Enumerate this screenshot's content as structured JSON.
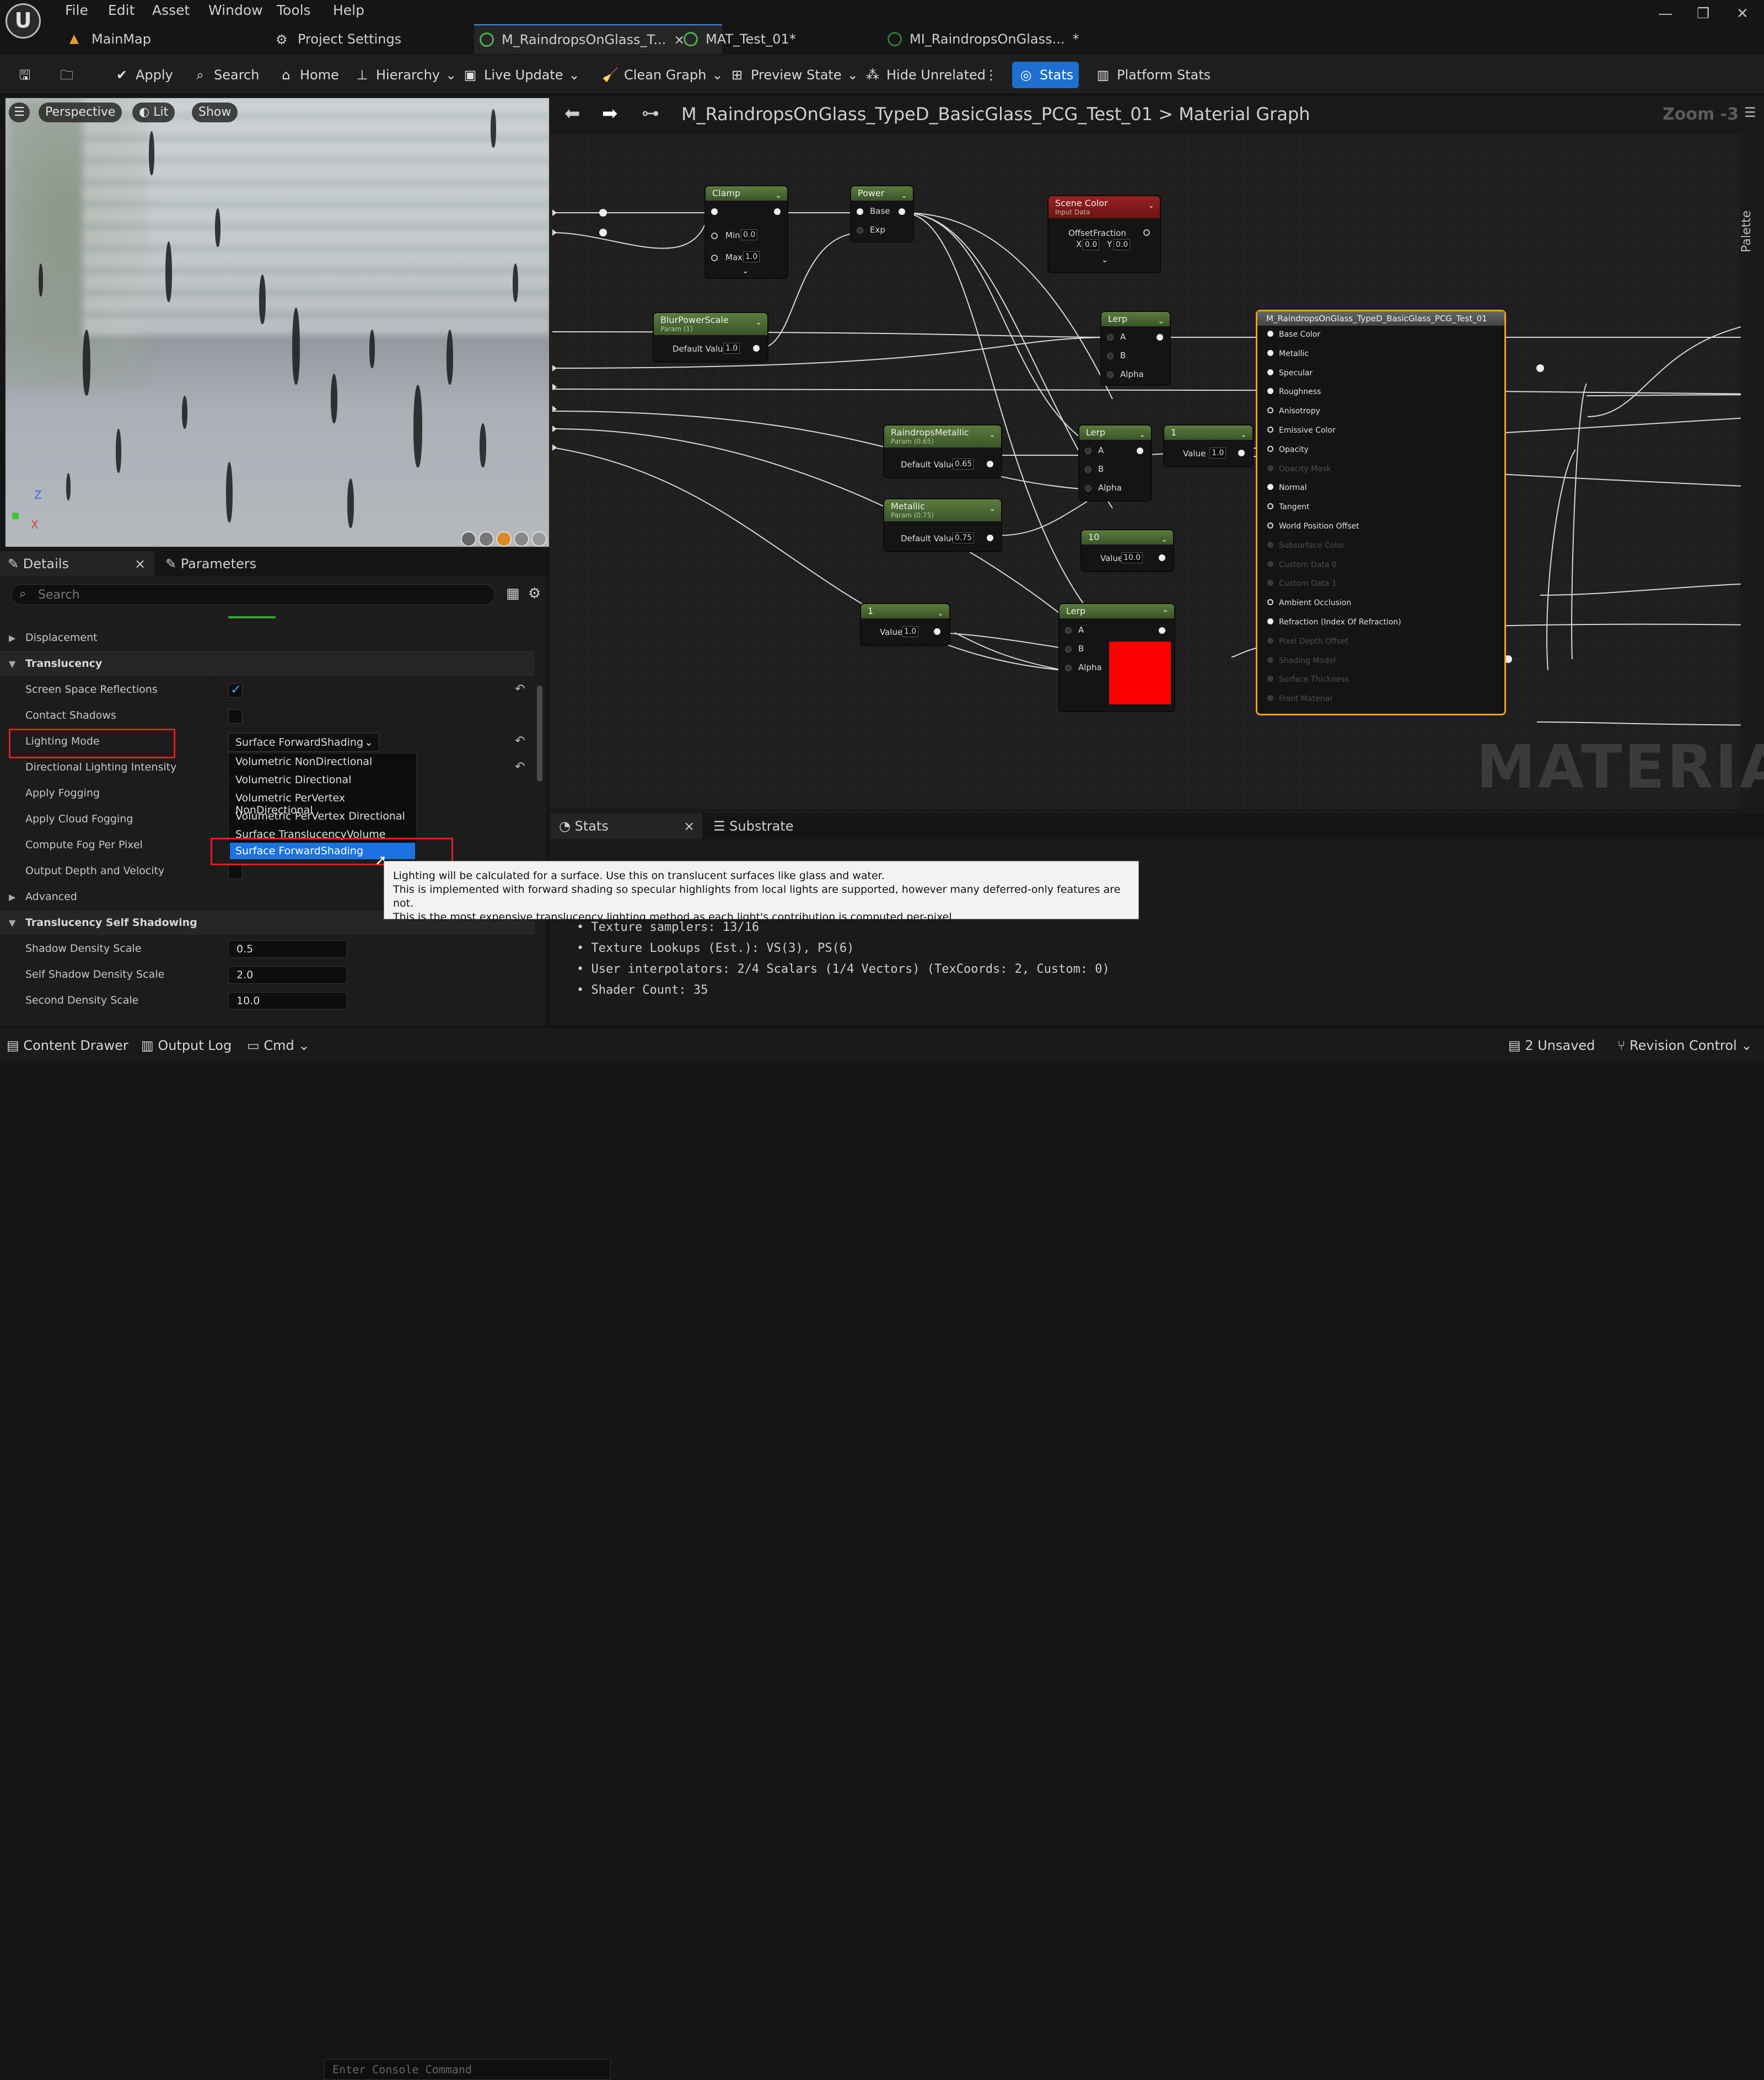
{
  "menu": [
    "File",
    "Edit",
    "Asset",
    "Window",
    "Tools",
    "Help"
  ],
  "tabs": [
    {
      "label": "MainMap",
      "icon": "level-icon"
    },
    {
      "label": "Project Settings",
      "icon": "settings-icon"
    },
    {
      "label": "M_RaindropsOnGlass_T...",
      "icon": "material-icon",
      "close": "×"
    },
    {
      "label": "MAT_Test_01*",
      "icon": "material-icon"
    },
    {
      "label": "MI_RaindropsOnGlass...",
      "icon": "material-instance-icon",
      "close": "*"
    }
  ],
  "toolbar": {
    "apply": "Apply",
    "search": "Search",
    "home": "Home",
    "hierarchy": "Hierarchy",
    "live_update": "Live Update",
    "clean_graph": "Clean Graph",
    "preview_state": "Preview State",
    "hide_unrelated": "Hide Unrelated",
    "stats": "Stats",
    "platform_stats": "Platform Stats"
  },
  "viewport": {
    "perspective": "Perspective",
    "lit": "Lit",
    "show": "Show",
    "axis_z": "Z",
    "axis_x": "X"
  },
  "details": {
    "tab_details": "Details",
    "tab_parameters": "Parameters",
    "search_placeholder": "Search",
    "rows": {
      "displacement": "Displacement",
      "translucency": "Translucency",
      "ssr": "Screen Space Reflections",
      "contact_shadows": "Contact Shadows",
      "lighting_mode": "Lighting Mode",
      "dir_light": "Directional Lighting Intensity",
      "apply_fog": "Apply Fogging",
      "cloud_fog": "Apply Cloud Fogging",
      "fog_pixel": "Compute Fog Per Pixel",
      "depth_velocity": "Output Depth and Velocity",
      "advanced": "Advanced",
      "self_shadow": "Translucency Self Shadowing",
      "shadow_density": "Shadow Density Scale",
      "self_shadow_density": "Self Shadow Density Scale",
      "second_density": "Second Density Scale"
    },
    "lighting_mode_value": "Surface ForwardShading",
    "shadow_density_value": "0.5",
    "self_shadow_density_value": "2.0",
    "second_density_value": "10.0",
    "ssr_checked": true
  },
  "dropdown": [
    "Volumetric NonDirectional",
    "Volumetric Directional",
    "Volumetric PerVertex NonDirectional",
    "Volumetric PerVertex Directional",
    "Surface TranslucencyVolume",
    "Surface ForwardShading"
  ],
  "tooltip": [
    "Lighting will be calculated for a surface. Use this on translucent surfaces like glass and water.",
    "This is implemented with forward shading so specular highlights from local lights are supported, however many deferred-only features are not.",
    "This is the most expensive translucency lighting method as each light's contribution is computed per-pixel."
  ],
  "graph": {
    "breadcrumb_material": "M_RaindropsOnGlass_TypeD_BasicGlass_PCG_Test_01",
    "breadcrumb_sep": ">",
    "breadcrumb_graph": "Material Graph",
    "zoom": "Zoom -3",
    "palette": "Palette",
    "watermark": "MATERIAL"
  },
  "nodes": {
    "clamp": {
      "title": "Clamp",
      "min_label": "Min",
      "min": "0.0",
      "max_label": "Max",
      "max": "1.0"
    },
    "power": {
      "title": "Power",
      "base": "Base",
      "exp": "Exp"
    },
    "scene_color": {
      "title": "Scene Color",
      "sub": "Input Data",
      "offset": "OffsetFraction",
      "x_label": "X",
      "x": "0.0",
      "y_label": "Y",
      "y": "0.0"
    },
    "blur": {
      "title": "BlurPowerScale",
      "sub": "Param (1)",
      "label": "Default Value",
      "value": "1.0"
    },
    "lerp1": {
      "title": "Lerp",
      "a": "A",
      "b": "B",
      "alpha": "Alpha"
    },
    "raindrops_metallic": {
      "title": "RaindropsMetallic",
      "sub": "Param (0.65)",
      "label": "Default Value",
      "value": "0.65"
    },
    "lerp2": {
      "title": "Lerp",
      "a": "A",
      "b": "B",
      "alpha": "Alpha"
    },
    "const1": {
      "title": "1",
      "label": "Value",
      "value": "1.0"
    },
    "metallic": {
      "title": "Metallic",
      "sub": "Param (0.75)",
      "label": "Default Value",
      "value": "0.75"
    },
    "const10": {
      "title": "10",
      "label": "Value",
      "value": "10.0"
    },
    "const1b": {
      "title": "1",
      "label": "Value",
      "value": "1.0"
    },
    "lerp3": {
      "title": "Lerp",
      "a": "A",
      "b": "B",
      "alpha": "Alpha",
      "preview_color": "#ff0000"
    }
  },
  "result_node": {
    "title": "M_RaindropsOnGlass_TypeD_BasicGlass_PCG_Test_01",
    "pins": [
      {
        "label": "Base Color",
        "state": "on"
      },
      {
        "label": "Metallic",
        "state": "on"
      },
      {
        "label": "Specular",
        "state": "on"
      },
      {
        "label": "Roughness",
        "state": "on"
      },
      {
        "label": "Anisotropy",
        "state": "hollow"
      },
      {
        "label": "Emissive Color",
        "state": "hollow"
      },
      {
        "label": "Opacity",
        "state": "hollow"
      },
      {
        "label": "Opacity Mask",
        "state": "dim"
      },
      {
        "label": "Normal",
        "state": "on"
      },
      {
        "label": "Tangent",
        "state": "hollow"
      },
      {
        "label": "World Position Offset",
        "state": "hollow"
      },
      {
        "label": "Subsurface Color",
        "state": "dim"
      },
      {
        "label": "Custom Data 0",
        "state": "dim"
      },
      {
        "label": "Custom Data 1",
        "state": "dim"
      },
      {
        "label": "Ambient Occlusion",
        "state": "hollow"
      },
      {
        "label": "Refraction (Index Of Refraction)",
        "state": "on"
      },
      {
        "label": "Pixel Depth Offset",
        "state": "dim"
      },
      {
        "label": "Shading Model",
        "state": "dim"
      },
      {
        "label": "Surface Thickness",
        "state": "dim"
      },
      {
        "label": "Front Material",
        "state": "dim"
      }
    ]
  },
  "stats": {
    "tab_stats": "Stats",
    "tab_substrate": "Substrate",
    "lines": [
      "• Texture samplers: 13/16",
      "• Texture Lookups (Est.): VS(3), PS(6)",
      "• User interpolators: 2/4 Scalars (1/4 Vectors) (TexCoords: 2, Custom: 0)",
      "• Shader Count: 35"
    ]
  },
  "statusbar": {
    "content_drawer": "Content Drawer",
    "output_log": "Output Log",
    "cmd": "Cmd",
    "console_placeholder": "Enter Console Command",
    "unsaved": "2 Unsaved",
    "revision": "Revision Control"
  },
  "colors": {
    "accent": "#1d6fd1",
    "highlight": "#e02020",
    "result_border": "#f0a020"
  }
}
